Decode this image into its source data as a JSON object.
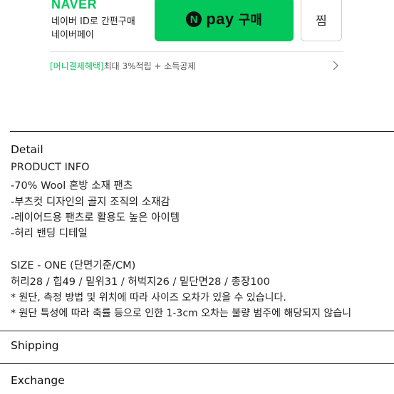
{
  "naver": {
    "logo": "NAVER",
    "line1": "네이버 ID로 간편구매",
    "line2": "네이버페이"
  },
  "npay_button": {
    "n_glyph": "N",
    "pay_label": "pay",
    "buy_label": "구매"
  },
  "zzim_button": {
    "label": "찜"
  },
  "benefit": {
    "tag": "[머니결제혜택]",
    "text": "최대 3%적립 + 소득공제"
  },
  "detail": {
    "title": "Detail",
    "product_info_heading": "PRODUCT INFO",
    "info_lines": [
      "-70% Wool 혼방 소재 팬츠",
      "-부츠컷 디자인의 골지 조직의 소재감",
      "-레이어드용 팬츠로 활용도 높은 아이템",
      "-허리 밴딩 디테일"
    ],
    "size_heading": "SIZE - ONE (단면기준/CM)",
    "measurements": "허리28 / 힙49 / 밑위31 / 허벅지26 / 밑단면28 / 총장100",
    "note1": "* 원단, 측정 방법 및 위치에 따라 사이즈 오차가 있을 수 있습니다.",
    "note2": "* 원단 특성에 따라 축률 등으로 인한 1-3cm 오차는 불량 범주에 해당되지 않습니"
  },
  "shipping": {
    "title": "Shipping"
  },
  "exchange": {
    "title": "Exchange"
  },
  "colors": {
    "naver_green": "#03c75a",
    "text": "#1a1a1a",
    "divider": "#222222"
  }
}
